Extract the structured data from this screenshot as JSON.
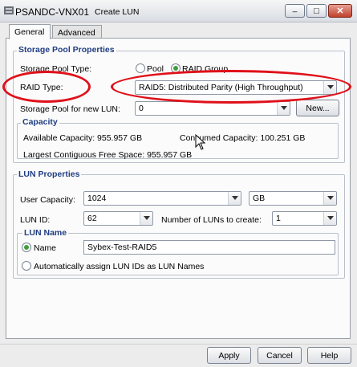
{
  "window": {
    "host": "PSANDC-VNX01",
    "title": "Create LUN",
    "minimize_label": "_",
    "maximize_label": "□",
    "close_label": "✕"
  },
  "tabs": [
    {
      "label": "General"
    },
    {
      "label": "Advanced"
    }
  ],
  "storage_pool": {
    "title": "Storage Pool Properties",
    "pool_type_label": "Storage Pool Type:",
    "pool_option": "Pool",
    "raid_group_option": "RAID Group",
    "raid_type_label": "RAID Type:",
    "raid_type_value": "RAID5: Distributed Parity (High Throughput)",
    "pool_for_lun_label": "Storage Pool for new LUN:",
    "pool_for_lun_value": "0",
    "new_button": "New..."
  },
  "capacity": {
    "title": "Capacity",
    "available": "Available Capacity: 955.957 GB",
    "consumed": "Consumed Capacity: 100.251 GB",
    "largest_free": "Largest Contiguous Free Space: 955.957 GB"
  },
  "lun": {
    "title": "LUN Properties",
    "user_capacity_label": "User Capacity:",
    "user_capacity_value": "1024",
    "unit_value": "GB",
    "lun_id_label": "LUN ID:",
    "lun_id_value": "62",
    "num_luns_label": "Number of LUNs to create:",
    "num_luns_value": "1"
  },
  "lun_name": {
    "title": "LUN Name",
    "name_option": "Name",
    "name_value": "Sybex-Test-RAID5",
    "auto_option": "Automatically assign LUN IDs as LUN Names"
  },
  "buttons": {
    "apply": "Apply",
    "cancel": "Cancel",
    "help": "Help"
  },
  "colors": {
    "group_title": "#1f3d82",
    "annotation": "#e0101a",
    "radio_selected": "#3c9e3c"
  }
}
